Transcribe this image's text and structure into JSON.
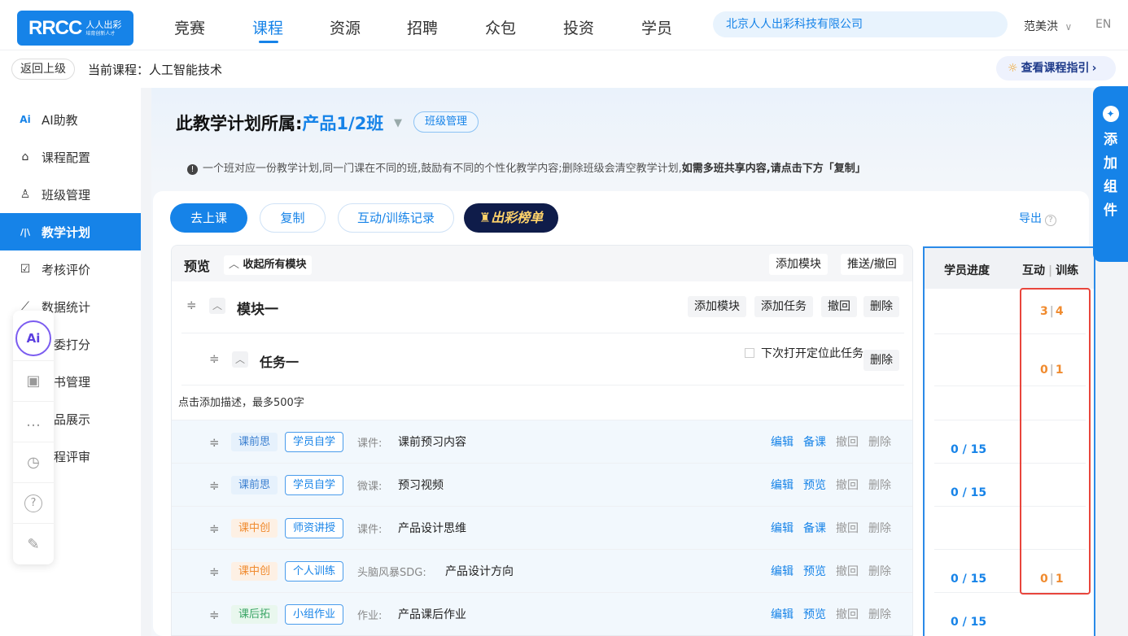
{
  "brand": {
    "logo": "RRCC",
    "logo_cn": "人人出彩",
    "logo_slogan": "培育创新人才",
    "accent": "#1683e8"
  },
  "nav": {
    "items": [
      "竞赛",
      "课程",
      "资源",
      "招聘",
      "众包",
      "投资",
      "学员"
    ],
    "active": "课程"
  },
  "company": "北京人人出彩科技有限公司",
  "user": {
    "name": "范美洪",
    "chevron": "∨",
    "lang": "EN"
  },
  "subbar": {
    "back": "返回上级",
    "current_course": "当前课程：人工智能技术",
    "guide": "查看课程指引"
  },
  "sidebar": {
    "items": [
      {
        "icon": "ai-icon",
        "glyph": "Ai",
        "label": "AI助教"
      },
      {
        "icon": "home-icon",
        "glyph": "⌂",
        "label": "课程配置"
      },
      {
        "icon": "user-group-icon",
        "glyph": "♙",
        "label": "班级管理"
      },
      {
        "icon": "plan-icon",
        "glyph": "/|\\",
        "label": "教学计划"
      },
      {
        "icon": "calendar-check-icon",
        "glyph": "☑",
        "label": "考核评价"
      },
      {
        "icon": "line-chart-icon",
        "glyph": "⟋",
        "label": "数据统计"
      },
      {
        "label": "委打分"
      },
      {
        "label": "书管理"
      },
      {
        "label": "品展示"
      },
      {
        "label": "程评审"
      }
    ],
    "active": "教学计划"
  },
  "float_tools": [
    {
      "icon": "ai-assistant-icon",
      "glyph": "Ai"
    },
    {
      "icon": "id-card-icon",
      "glyph": "▣"
    },
    {
      "icon": "chat-bubble-icon",
      "glyph": "…"
    },
    {
      "icon": "timer-icon",
      "glyph": "◷"
    },
    {
      "icon": "help-icon",
      "glyph": "?"
    },
    {
      "icon": "edit-icon",
      "glyph": "✎"
    }
  ],
  "plan": {
    "title_prefix": "此教学计划所属:",
    "class_name": "产品1/2班",
    "class_mgmt": "班级管理",
    "notice_plain": "一个班对应一份教学计划,同一门课在不同的班,鼓励有不同的个性化教学内容;删除班级会清空教学计划,",
    "notice_bold": "如需多班共享内容,请点击下方「复制」"
  },
  "toolbar": {
    "go_class": "去上课",
    "copy": "复制",
    "records": "互动/训练记录",
    "rank": "出彩榜单",
    "export": "导出",
    "export_help": "?"
  },
  "preview": {
    "title": "预览",
    "collapse_all": "收起所有模块",
    "add_module": "添加模块",
    "push_recall": "推送/撤回"
  },
  "module": {
    "name": "模块一",
    "add_module": "添加模块",
    "add_task": "添加任务",
    "recall": "撤回",
    "delete": "删除"
  },
  "task": {
    "name": "任务一",
    "locate": "下次打开定位此任务",
    "delete": "删除"
  },
  "desc_placeholder": "点击添加描述，最多500字",
  "resources": [
    {
      "stage": "课前思",
      "stage_color": "blue",
      "mode": "学员自学",
      "type": "课件:",
      "name": "课前预习内容",
      "actions": [
        "编辑",
        "备课",
        "撤回",
        "删除"
      ]
    },
    {
      "stage": "课前思",
      "stage_color": "blue",
      "mode": "学员自学",
      "type": "微课:",
      "name": "预习视频",
      "actions": [
        "编辑",
        "预览",
        "撤回",
        "删除"
      ]
    },
    {
      "stage": "课中创",
      "stage_color": "orange",
      "mode": "师资讲授",
      "type": "课件:",
      "name": "产品设计思维",
      "actions": [
        "编辑",
        "备课",
        "撤回",
        "删除"
      ]
    },
    {
      "stage": "课中创",
      "stage_color": "orange",
      "mode": "个人训练",
      "type": "头脑风暴SDG:",
      "name": "产品设计方向",
      "actions": [
        "编辑",
        "预览",
        "撤回",
        "删除"
      ]
    },
    {
      "stage": "课后拓",
      "stage_color": "green",
      "mode": "小组作业",
      "type": "作业:",
      "name": "产品课后作业",
      "actions": [
        "编辑",
        "预览",
        "撤回",
        "删除"
      ]
    }
  ],
  "stats": {
    "progress_header": "学员进度",
    "interact_header": "互动",
    "train_header": "训练",
    "rows": [
      {
        "progress": "",
        "interact": "3",
        "train": "4"
      },
      {
        "progress": "",
        "interact": "0",
        "train": "1"
      },
      {
        "progress": "",
        "interact": "",
        "train": ""
      },
      {
        "progress": "0 / 15",
        "interact": "",
        "train": ""
      },
      {
        "progress": "0 / 15",
        "interact": "",
        "train": ""
      },
      {
        "progress": "",
        "interact": "",
        "train": ""
      },
      {
        "progress": "0 / 15",
        "interact": "0",
        "train": "1"
      },
      {
        "progress": "0 / 15",
        "interact": "",
        "train": ""
      }
    ]
  },
  "add_widget": {
    "label_chars": [
      "添",
      "加",
      "组",
      "件"
    ]
  }
}
